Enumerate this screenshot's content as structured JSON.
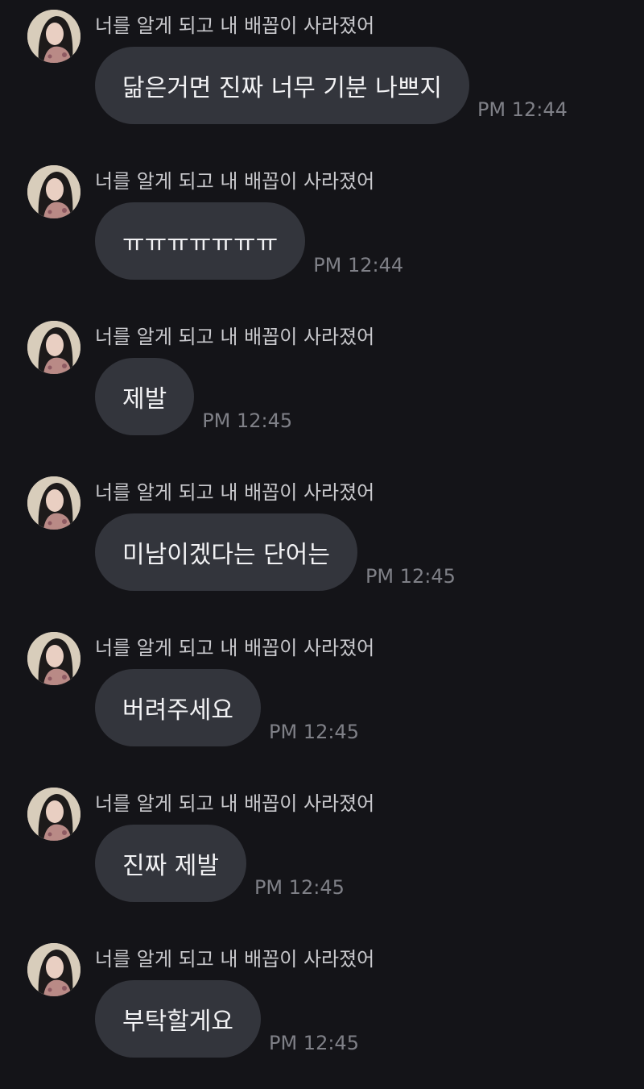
{
  "sender_name": "너를 알게 되고 내 배꼽이 사라졌어",
  "messages": [
    {
      "text": "닮은거면 진짜 너무 기분 나쁘지",
      "time": "PM 12:44"
    },
    {
      "text": "ㅠㅠㅠㅠㅠㅠㅠ",
      "time": "PM 12:44"
    },
    {
      "text": "제발",
      "time": "PM 12:45"
    },
    {
      "text": "미남이겠다는 단어는",
      "time": "PM 12:45"
    },
    {
      "text": "버려주세요",
      "time": "PM 12:45"
    },
    {
      "text": "진짜 제발",
      "time": "PM 12:45"
    },
    {
      "text": "부탁할게요",
      "time": "PM 12:45"
    }
  ],
  "colors": {
    "background": "#141418",
    "bubble": "#33353c",
    "bubble_text": "#f2f2f4",
    "sender_text": "#c9c9cd",
    "time_text": "#7f8087"
  },
  "icons": {
    "avatar": "profile-photo-avatar"
  }
}
